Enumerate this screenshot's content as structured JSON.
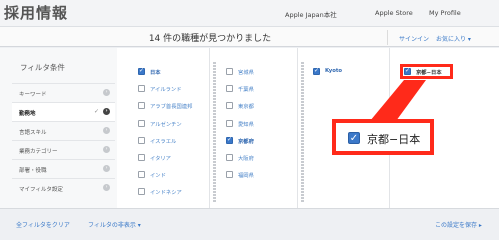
{
  "header": {
    "brand": "採用情報",
    "nav": [
      "Apple Japan本社",
      "Apple Store",
      "My Profile"
    ]
  },
  "results": {
    "count_text": "14 件の職種が見つかりました",
    "signin": "サインイン",
    "favorites": "お気に入り ▾"
  },
  "sidebar": {
    "title": "フィルタ条件",
    "items": [
      {
        "label": "キーワード",
        "state": "off"
      },
      {
        "label": "勤務地",
        "state": "active"
      },
      {
        "label": "言語スキル",
        "state": "off"
      },
      {
        "label": "業務カテゴリー",
        "state": "off"
      },
      {
        "label": "部署・役職",
        "state": "off"
      },
      {
        "label": "マイフィルタ設定",
        "state": "off"
      }
    ],
    "active_tick": "✓",
    "dot_glyph": "›"
  },
  "locations": {
    "col1": [
      {
        "label": "日本",
        "checked": true
      },
      {
        "label": "アイルランド",
        "checked": false
      },
      {
        "label": "アラブ首長国連邦",
        "checked": false
      },
      {
        "label": "アルゼンチン",
        "checked": false
      },
      {
        "label": "イスラエル",
        "checked": false
      },
      {
        "label": "イタリア",
        "checked": false
      },
      {
        "label": "インド",
        "checked": false
      },
      {
        "label": "インドネシア",
        "checked": false
      }
    ],
    "col2": [
      {
        "label": "宮城県",
        "checked": false
      },
      {
        "label": "千葉県",
        "checked": false
      },
      {
        "label": "東京都",
        "checked": false
      },
      {
        "label": "愛知県",
        "checked": false
      },
      {
        "label": "京都府",
        "checked": true
      },
      {
        "label": "大阪府",
        "checked": false
      },
      {
        "label": "福岡県",
        "checked": false
      }
    ],
    "col3": [
      {
        "label": "Kyoto",
        "checked": true
      }
    ],
    "col4": [
      {
        "label": "京都−日本",
        "checked": true
      }
    ]
  },
  "callout": {
    "label": "京都−日本",
    "check_glyph": "✓",
    "color": "#ff2a1a"
  },
  "footer": {
    "clear_all": "全フィルタをクリア",
    "hide_filters": "フィルタの非表示 ▾",
    "save": "この設定を保存 ▸"
  },
  "colors": {
    "accent": "#3b78c9",
    "link": "#3a79c8",
    "highlight": "#ff2a1a"
  }
}
